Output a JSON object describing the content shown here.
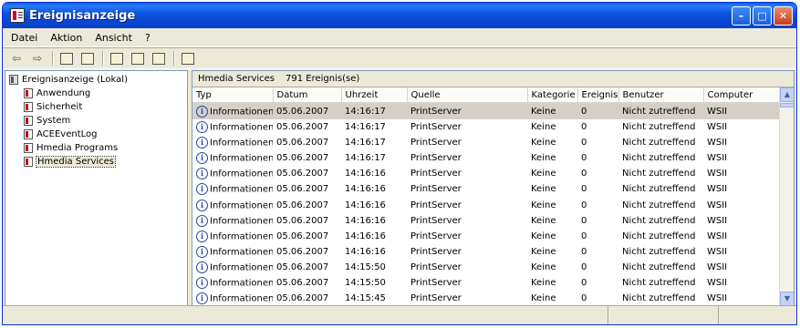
{
  "window": {
    "title": "Ereignisanzeige"
  },
  "menu": [
    "Datei",
    "Aktion",
    "Ansicht",
    "?"
  ],
  "tree": {
    "root": "Ereignisanzeige (Lokal)",
    "children": [
      "Anwendung",
      "Sicherheit",
      "System",
      "ACEEventLog",
      "Hmedia Programs",
      "Hmedia Services"
    ],
    "selected": "Hmedia Services"
  },
  "panel": {
    "name": "Hmedia Services",
    "count": "791 Ereignis(se)"
  },
  "columns": [
    "Typ",
    "Datum",
    "Uhrzeit",
    "Quelle",
    "Kategorie",
    "Ereignis",
    "Benutzer",
    "Computer"
  ],
  "rows": [
    [
      "Informationen",
      "05.06.2007",
      "14:16:17",
      "PrintServer",
      "Keine",
      "0",
      "Nicht zutreffend",
      "WSII"
    ],
    [
      "Informationen",
      "05.06.2007",
      "14:16:17",
      "PrintServer",
      "Keine",
      "0",
      "Nicht zutreffend",
      "WSII"
    ],
    [
      "Informationen",
      "05.06.2007",
      "14:16:17",
      "PrintServer",
      "Keine",
      "0",
      "Nicht zutreffend",
      "WSII"
    ],
    [
      "Informationen",
      "05.06.2007",
      "14:16:17",
      "PrintServer",
      "Keine",
      "0",
      "Nicht zutreffend",
      "WSII"
    ],
    [
      "Informationen",
      "05.06.2007",
      "14:16:16",
      "PrintServer",
      "Keine",
      "0",
      "Nicht zutreffend",
      "WSII"
    ],
    [
      "Informationen",
      "05.06.2007",
      "14:16:16",
      "PrintServer",
      "Keine",
      "0",
      "Nicht zutreffend",
      "WSII"
    ],
    [
      "Informationen",
      "05.06.2007",
      "14:16:16",
      "PrintServer",
      "Keine",
      "0",
      "Nicht zutreffend",
      "WSII"
    ],
    [
      "Informationen",
      "05.06.2007",
      "14:16:16",
      "PrintServer",
      "Keine",
      "0",
      "Nicht zutreffend",
      "WSII"
    ],
    [
      "Informationen",
      "05.06.2007",
      "14:16:16",
      "PrintServer",
      "Keine",
      "0",
      "Nicht zutreffend",
      "WSII"
    ],
    [
      "Informationen",
      "05.06.2007",
      "14:16:16",
      "PrintServer",
      "Keine",
      "0",
      "Nicht zutreffend",
      "WSII"
    ],
    [
      "Informationen",
      "05.06.2007",
      "14:15:50",
      "PrintServer",
      "Keine",
      "0",
      "Nicht zutreffend",
      "WSII"
    ],
    [
      "Informationen",
      "05.06.2007",
      "14:15:50",
      "PrintServer",
      "Keine",
      "0",
      "Nicht zutreffend",
      "WSII"
    ],
    [
      "Informationen",
      "05.06.2007",
      "14:15:45",
      "PrintServer",
      "Keine",
      "0",
      "Nicht zutreffend",
      "WSII"
    ]
  ],
  "selected_row": 0,
  "colors": {
    "titlebar": "#0a47d3",
    "chrome": "#ece9d8",
    "selection": "#d4d0c8"
  }
}
